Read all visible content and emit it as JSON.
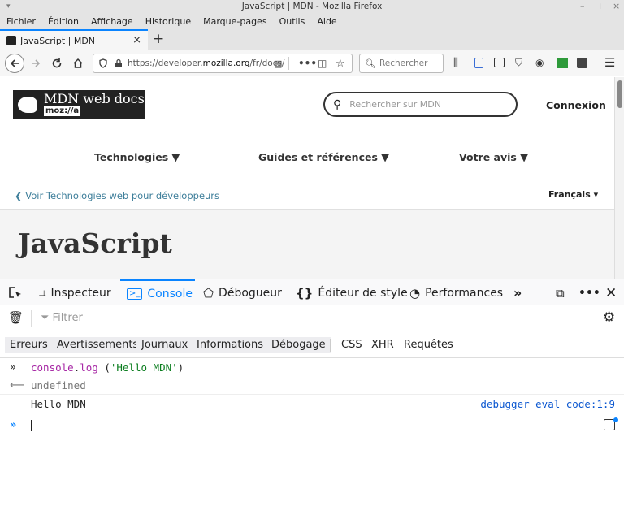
{
  "window": {
    "title": "JavaScript | MDN - Mozilla Firefox",
    "controls": [
      "–",
      "+",
      "×"
    ]
  },
  "menu": {
    "items": [
      {
        "label": "Fichier"
      },
      {
        "label": "Édition"
      },
      {
        "label": "Affichage"
      },
      {
        "label": "Historique"
      },
      {
        "label": "Marque-pages"
      },
      {
        "label": "Outils"
      },
      {
        "label": "Aide"
      }
    ]
  },
  "tab": {
    "title": "JavaScript | MDN",
    "close": "×",
    "new_tab": "+"
  },
  "nav": {
    "url_prefix": "https://developer.",
    "url_domain": "mozilla.org",
    "url_suffix": "/fr/docs/",
    "search_placeholder": "Rechercher"
  },
  "page": {
    "logo_title": "MDN web docs",
    "logo_sub": "moz://a",
    "search_placeholder": "Rechercher sur MDN",
    "login": "Connexion",
    "nav_links": [
      "Technologies ▼",
      "Guides et références ▼",
      "Votre avis ▼"
    ],
    "breadcrumb": "❮  Voir Technologies web pour développeurs",
    "language": "Français ▾",
    "heading": "JavaScript"
  },
  "devtools": {
    "tabs": [
      {
        "label": "Inspecteur",
        "icon": "inspector-icon"
      },
      {
        "label": "Console",
        "icon": "console-icon"
      },
      {
        "label": "Débogueur",
        "icon": "debugger-icon"
      },
      {
        "label": "Éditeur de style",
        "icon": "style-editor-icon"
      },
      {
        "label": "Performances",
        "icon": "performance-icon"
      }
    ],
    "filter_placeholder": "Filtrer",
    "categories": [
      "Erreurs",
      "Avertissements",
      "Journaux",
      "Informations",
      "Débogage",
      "CSS",
      "XHR",
      "Requêtes"
    ]
  },
  "console": {
    "input_fn": "console",
    "input_method": "log",
    "input_open": " (",
    "input_arg": "'Hello MDN'",
    "input_close": ")",
    "result": "undefined",
    "output": "Hello MDN",
    "location": "debugger eval code:1:9"
  }
}
